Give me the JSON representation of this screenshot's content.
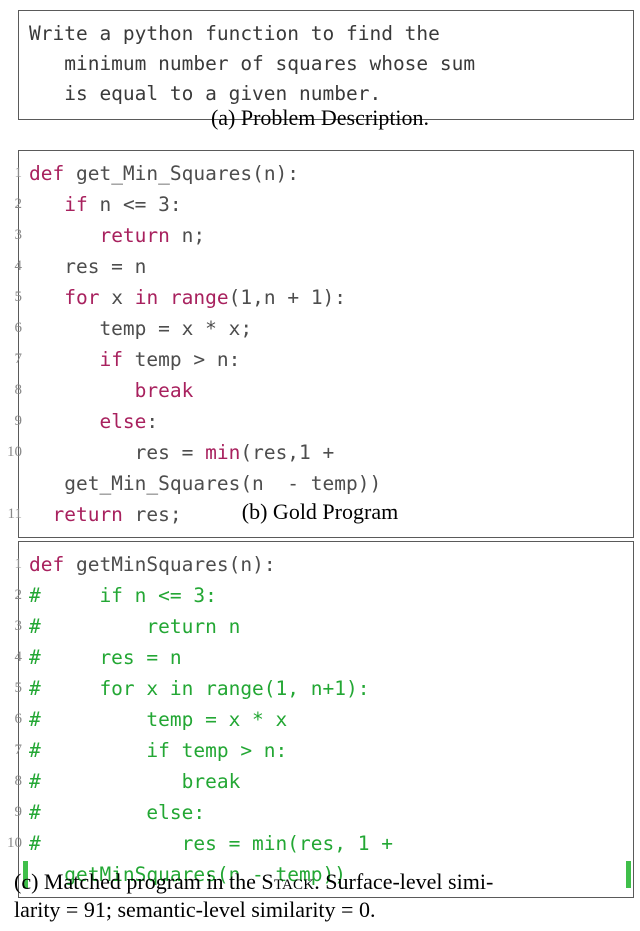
{
  "figure": {
    "panel_a": {
      "caption": "(a) Problem Description.",
      "lines": [
        "Write a python function to find the",
        "   minimum number of squares whose sum",
        "   is equal to a given number."
      ]
    },
    "panel_b": {
      "caption": "(b) Gold Program",
      "lines": [
        {
          "num": "1",
          "segments": [
            {
              "t": "def",
              "c": "kw"
            },
            {
              "t": " get_Min_Squares(n):",
              "c": "plain"
            }
          ]
        },
        {
          "num": "2",
          "segments": [
            {
              "t": "   ",
              "c": "plain"
            },
            {
              "t": "if",
              "c": "kw"
            },
            {
              "t": " n <= 3:",
              "c": "plain"
            }
          ]
        },
        {
          "num": "3",
          "segments": [
            {
              "t": "      ",
              "c": "plain"
            },
            {
              "t": "return",
              "c": "kw"
            },
            {
              "t": " n;",
              "c": "plain"
            }
          ]
        },
        {
          "num": "4",
          "segments": [
            {
              "t": "   res = n",
              "c": "plain"
            }
          ]
        },
        {
          "num": "5",
          "segments": [
            {
              "t": "   ",
              "c": "plain"
            },
            {
              "t": "for",
              "c": "kw"
            },
            {
              "t": " x ",
              "c": "plain"
            },
            {
              "t": "in",
              "c": "kw"
            },
            {
              "t": " ",
              "c": "plain"
            },
            {
              "t": "range",
              "c": "kw"
            },
            {
              "t": "(1,n + 1):",
              "c": "plain"
            }
          ]
        },
        {
          "num": "6",
          "segments": [
            {
              "t": "      temp = x * x;",
              "c": "plain"
            }
          ]
        },
        {
          "num": "7",
          "segments": [
            {
              "t": "      ",
              "c": "plain"
            },
            {
              "t": "if",
              "c": "kw"
            },
            {
              "t": " temp > n:",
              "c": "plain"
            }
          ]
        },
        {
          "num": "8",
          "segments": [
            {
              "t": "         ",
              "c": "plain"
            },
            {
              "t": "break",
              "c": "kw"
            }
          ]
        },
        {
          "num": "9",
          "segments": [
            {
              "t": "      ",
              "c": "plain"
            },
            {
              "t": "else",
              "c": "kw"
            },
            {
              "t": ":",
              "c": "plain"
            }
          ]
        },
        {
          "num": "10",
          "segments": [
            {
              "t": "         res = ",
              "c": "plain"
            },
            {
              "t": "min",
              "c": "kw"
            },
            {
              "t": "(res,1 +",
              "c": "plain"
            }
          ]
        },
        {
          "num": "",
          "segments": [
            {
              "t": "   get_Min_Squares(n  - temp))",
              "c": "plain"
            }
          ]
        },
        {
          "num": "11",
          "segments": [
            {
              "t": "  ",
              "c": "plain"
            },
            {
              "t": "return",
              "c": "kw"
            },
            {
              "t": " res;",
              "c": "plain"
            }
          ]
        }
      ]
    },
    "panel_c": {
      "caption_line_1": "(c) Matched program in the ",
      "caption_stack": "Stack",
      "caption_line_2": ". Surface-level simi-",
      "caption_line_3": "larity = 91; semantic-level similarity = 0.",
      "surface_similarity": "91",
      "semantic_similarity": "0",
      "lines": [
        {
          "num": "1",
          "marker": false,
          "segments": [
            {
              "t": "def",
              "c": "kw"
            },
            {
              "t": " getMinSquares(n):",
              "c": "plain"
            }
          ]
        },
        {
          "num": "2",
          "marker": false,
          "segments": [
            {
              "t": "#     if n <= 3:",
              "c": "cmt"
            }
          ]
        },
        {
          "num": "3",
          "marker": false,
          "segments": [
            {
              "t": "#         return n",
              "c": "cmt"
            }
          ]
        },
        {
          "num": "4",
          "marker": false,
          "segments": [
            {
              "t": "#     res = n",
              "c": "cmt"
            }
          ]
        },
        {
          "num": "5",
          "marker": false,
          "segments": [
            {
              "t": "#     for x in range(1, n+1):",
              "c": "cmt"
            }
          ]
        },
        {
          "num": "6",
          "marker": false,
          "segments": [
            {
              "t": "#         temp = x * x",
              "c": "cmt"
            }
          ]
        },
        {
          "num": "7",
          "marker": false,
          "segments": [
            {
              "t": "#         if temp > n:",
              "c": "cmt"
            }
          ]
        },
        {
          "num": "8",
          "marker": false,
          "segments": [
            {
              "t": "#            break",
              "c": "cmt"
            }
          ]
        },
        {
          "num": "9",
          "marker": false,
          "segments": [
            {
              "t": "#         else:",
              "c": "cmt"
            }
          ]
        },
        {
          "num": "10",
          "marker": false,
          "segments": [
            {
              "t": "#            res = min(res, 1 +",
              "c": "cmt"
            }
          ]
        },
        {
          "num": "",
          "marker": true,
          "segments": [
            {
              "t": "   getMinSquares(n - temp))",
              "c": "cmt"
            }
          ]
        }
      ]
    }
  },
  "colors": {
    "keyword": "#a8215e",
    "comment": "#23a734",
    "code_text": "#4d4d4d",
    "border": "#5a5a5a",
    "line_number": "#8a8a8a",
    "marker_green": "#3fbf4a"
  }
}
